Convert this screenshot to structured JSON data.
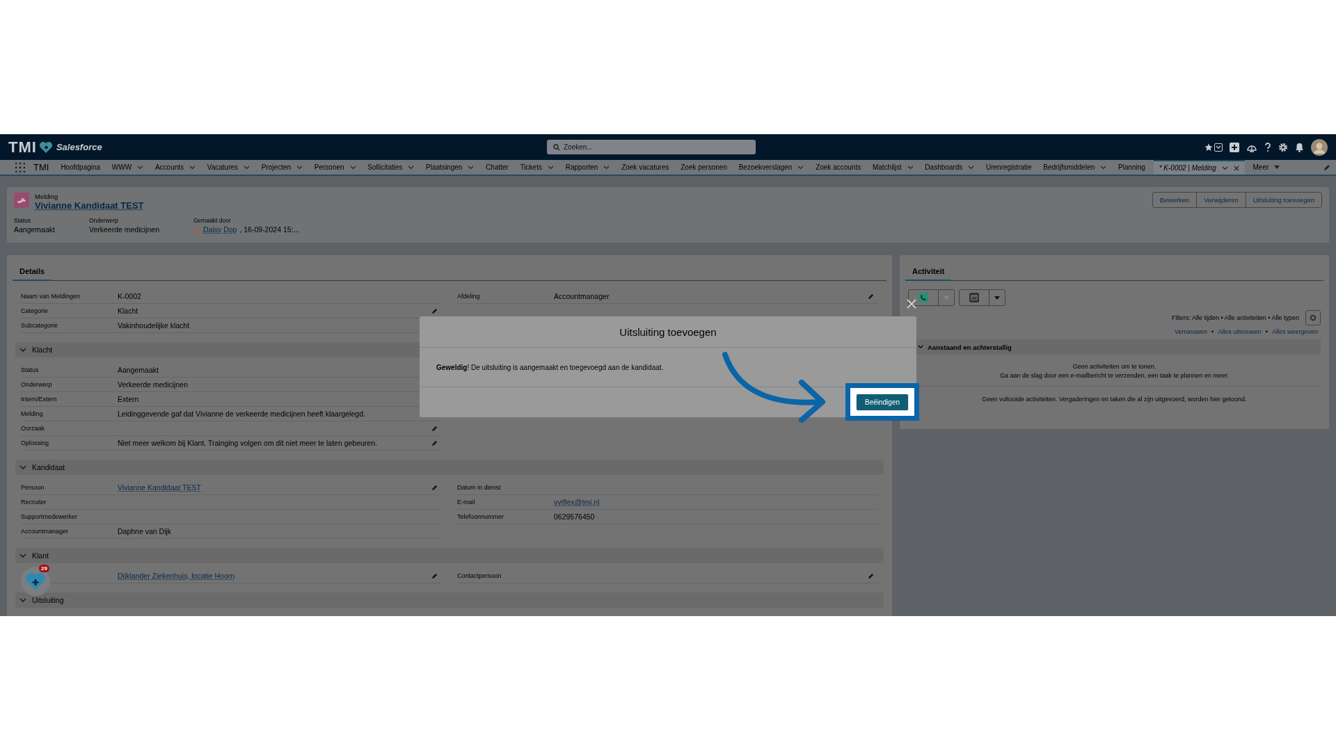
{
  "topbar": {
    "logo": "TMI",
    "brand": "Salesforce",
    "search": {
      "placeholder": "Zoeken..."
    }
  },
  "nav": {
    "app_name": "TMI",
    "items": [
      {
        "label": "Hoofdpagina",
        "dropdown": false,
        "selected": false
      },
      {
        "label": "WWW",
        "dropdown": true,
        "selected": false
      },
      {
        "label": "Accounts",
        "dropdown": true,
        "selected": false
      },
      {
        "label": "Vacatures",
        "dropdown": true,
        "selected": false
      },
      {
        "label": "Projecten",
        "dropdown": true,
        "selected": false
      },
      {
        "label": "Personen",
        "dropdown": true,
        "selected": false
      },
      {
        "label": "Sollicitaties",
        "dropdown": true,
        "selected": false
      },
      {
        "label": "Plaatsingen",
        "dropdown": true,
        "selected": false
      },
      {
        "label": "Chatter",
        "dropdown": false,
        "selected": false
      },
      {
        "label": "Tickets",
        "dropdown": true,
        "selected": false
      },
      {
        "label": "Rapporten",
        "dropdown": true,
        "selected": false
      },
      {
        "label": "Zoek vacatures",
        "dropdown": false,
        "selected": false
      },
      {
        "label": "Zoek personen",
        "dropdown": false,
        "selected": false
      },
      {
        "label": "Bezoekverslagen",
        "dropdown": true,
        "selected": false
      },
      {
        "label": "Zoek accounts",
        "dropdown": false,
        "selected": false
      },
      {
        "label": "Matchlijst",
        "dropdown": true,
        "selected": false
      },
      {
        "label": "Dashboards",
        "dropdown": true,
        "selected": false
      },
      {
        "label": "Urenregistratie",
        "dropdown": false,
        "selected": false
      },
      {
        "label": "Bedrijfsmiddelen",
        "dropdown": true,
        "selected": false
      },
      {
        "label": "Planning",
        "dropdown": false,
        "selected": false
      },
      {
        "label": "* K-0002 | Melding",
        "dropdown": true,
        "selected": true,
        "closable": true
      }
    ],
    "more_label": "Meer"
  },
  "record_header": {
    "object_type": "Melding",
    "title": "Vivianne Kandidaat TEST",
    "fields": [
      {
        "kind": "text",
        "label": "Status",
        "value": "Aangemaakt"
      },
      {
        "kind": "text",
        "label": "Onderwerp",
        "value": "Verkeerde medicijnen"
      },
      {
        "kind": "user",
        "label": "Gemaakt door",
        "link": "Daisy Dop",
        "suffix": ", 16-09-2024 15:..."
      }
    ],
    "buttons": [
      "Bewerken",
      "Verwijderen",
      "Uitsluiting toevoegen"
    ]
  },
  "details": {
    "tab": "Details",
    "top": {
      "left": [
        {
          "label": "Naam van Meldingen",
          "value": "K-0002",
          "link": false,
          "editable": false
        },
        {
          "label": "Categorie",
          "value": "Klacht",
          "link": false,
          "editable": true
        },
        {
          "label": "Subcategorie",
          "value": "Vakinhoudelijke klacht",
          "link": false,
          "editable": false
        }
      ],
      "right": [
        {
          "label": "Afdeling",
          "value": "Accountmanager",
          "link": false,
          "editable": true
        }
      ]
    },
    "sections": [
      {
        "title": "Klacht",
        "expanded": true,
        "left": [
          {
            "label": "Status",
            "value": "Aangemaakt",
            "link": false,
            "editable": false
          },
          {
            "label": "Onderwerp",
            "value": "Verkeerde medicijnen",
            "link": false,
            "editable": false
          },
          {
            "label": "Intern/Extern",
            "value": "Extern",
            "link": false,
            "editable": false
          },
          {
            "label": "Melding",
            "value": "Leidinggevende gaf dat Vivianne de verkeerde medicijnen heeft klaargelegd.",
            "link": false,
            "editable": false
          },
          {
            "label": "Oorzaak",
            "editable": true
          },
          {
            "label": "Oplossing",
            "value": "Niet meer welkom bij Klant. Trainging volgen om dit niet meer te laten gebeuren.",
            "link": false,
            "editable": true
          }
        ]
      },
      {
        "title": "Kandidaat",
        "expanded": true,
        "left": [
          {
            "label": "Persoon",
            "value": "Vivianne Kandidaat TEST",
            "link": true,
            "editable": true
          },
          {
            "label": "Recruiter",
            "editable": false
          },
          {
            "label": "Supportmedewerker",
            "editable": false
          },
          {
            "label": "Accountmanager",
            "value": "Daphne van Dijk",
            "link": false,
            "editable": false
          }
        ],
        "right": [
          {
            "label": "Datum in dienst",
            "editable": false
          },
          {
            "label": "E-mail",
            "value": "vvtflex@tmi.nl",
            "link": true,
            "editable": false
          },
          {
            "label": "Telefoonnummer",
            "value": "0629576450",
            "link": false,
            "editable": false
          }
        ]
      },
      {
        "title": "Klant",
        "expanded": true,
        "left": [
          {
            "value": "Dijklander Ziekenhuis, locatie Hoorn",
            "link": true,
            "editable": true
          }
        ],
        "right": [
          {
            "label": "Contactpersoon",
            "editable": true
          }
        ]
      },
      {
        "title": "Uitsluiting",
        "expanded": true
      }
    ]
  },
  "activity": {
    "tab": "Activiteit",
    "filters": "Filters: Alle tijden • Alle activiteiten • Alle typen",
    "links": [
      "Vernieuwen",
      "Alles uitvouwen",
      "Alles weergeven"
    ],
    "separator": "•",
    "section": {
      "title": "Aanstaand en achterstallig",
      "expanded": true
    },
    "empty_lines": [
      "Geen activiteiten om te tonen.",
      "Ga aan de slag door een e-mailbericht te verzenden, een taak te plannen en meer."
    ],
    "completed_note": "Geen voltooide activiteiten. Vergaderingen en taken die al zijn uitgevoerd, worden hier getoond."
  },
  "modal": {
    "title": "Uitsluiting toevoegen",
    "message": "**Geweldig**! De uitsluiting is aangemaakt en toegevoegd aan de kandidaat.",
    "button": "Beëindigen"
  },
  "badge": {
    "count": "29"
  }
}
